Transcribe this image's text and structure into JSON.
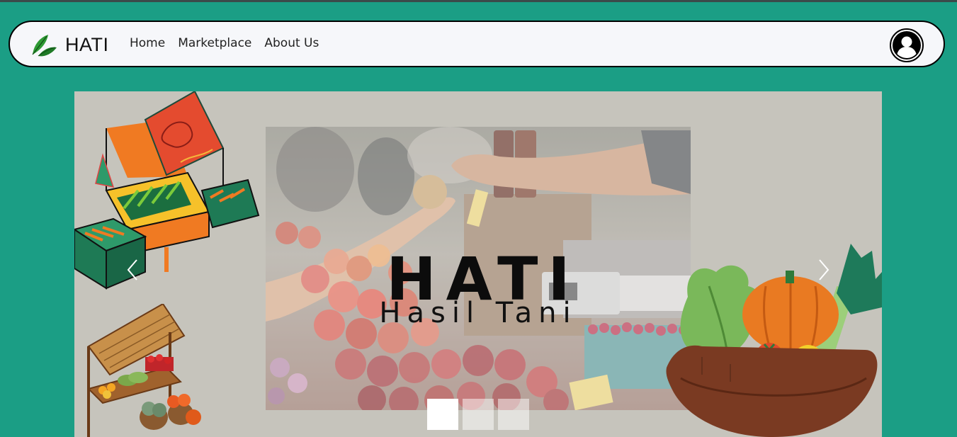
{
  "app": {
    "brand_name": "HATI"
  },
  "nav": {
    "items": [
      {
        "label": "Home"
      },
      {
        "label": "Marketplace"
      },
      {
        "label": "About Us"
      }
    ],
    "profile_icon": "user-circle-icon"
  },
  "hero": {
    "title": "HATI",
    "subtitle": "Hasil Tani",
    "prev_icon": "chevron-left-icon",
    "next_icon": "chevron-right-icon",
    "slide_count": 3,
    "active_slide": 1
  },
  "colors": {
    "page_bg": "#1b9e85",
    "navbar_bg": "#f6f7fa",
    "hero_bg": "#c6c4bc",
    "accent_green": "#1e8a4c"
  }
}
